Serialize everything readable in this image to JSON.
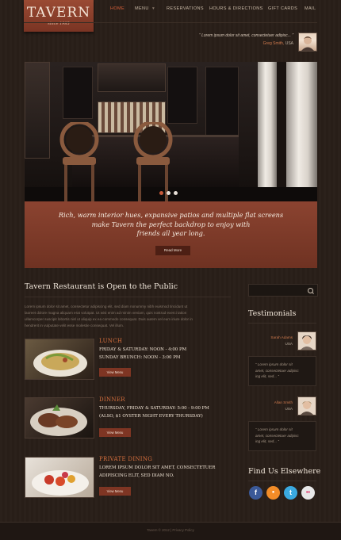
{
  "brand": {
    "name": "TAVERN",
    "since": "since 1985"
  },
  "nav": [
    {
      "label": "HOME",
      "active": true
    },
    {
      "label": "MENU"
    },
    {
      "label": "RESERVATIONS"
    },
    {
      "label": "HOURS & DIRECTIONS"
    },
    {
      "label": "GIFT CARDS"
    },
    {
      "label": "MAIL"
    }
  ],
  "header_testimonial": {
    "quote": "“ Lorem ipsum dolor sit amet, consectetuer adipisc... ”",
    "author": "Greg Smith,",
    "location": "USA"
  },
  "hero": {
    "caption": [
      "Rich, warm interior hues, expansive patios and multiple flat screens",
      "make Tavern the perfect backdrop to enjoy with",
      "friends all year long."
    ],
    "read_more": "Read More"
  },
  "main": {
    "title": "Tavern Restaurant is Open to the Public",
    "intro": [
      "Lorem ipsum dolor sit amet, consectetur adipiscing elit, sed diam nonummy nibh euismod tincidunt ut",
      "laoreet dolore magna aliquam erat volutpat. Ut wisi enim ad minim veniam, quis nostrud exerci tation",
      "ullamcorper suscipit lobortis nisl ut aliquip ex ea commodo consequat. Duis autem vel eum iriure dolor in",
      "hendrerit in vulputate velit esse molestie consequat. Vel illum."
    ],
    "cards": [
      {
        "heading": "LUNCH",
        "lines": [
          "FRIDAY & SATURDAY: NOON - 4:00 PM",
          "SUNDAY BRUNCH: NOON - 3:00 PM"
        ],
        "button": "View Menu"
      },
      {
        "heading": "DINNER",
        "lines": [
          "THURSDAY, FRIDAY & SATURDAY: 5:00 - 9:00 PM",
          "(ALSO, $1 OYSTER NIGHT EVERY THURSDAY)"
        ],
        "button": "View Menu"
      },
      {
        "heading": "PRIVATE DINING",
        "lines": [
          "LOREM IPSUM DOLOR SIT AMET, CONSECTETUER",
          "ADIPISCING ELIT, SED DIAM NO."
        ],
        "button": "View Menu"
      }
    ]
  },
  "sidebar": {
    "testimonials_title": "Testimonials",
    "testimonials": [
      {
        "name": "Sarah Adams",
        "location": "USA",
        "quote": [
          "“ Lorem ipsum dolor sit",
          "amet, consectetuer adipisc",
          "ing elit, sed... ”"
        ]
      },
      {
        "name": "Allan Smith",
        "location": "USA",
        "quote": [
          "“ Lorem ipsum dolor sit",
          "amet, consectetuer adipisc",
          "ing elit, sed... ”"
        ]
      }
    ],
    "social_title": "Find Us Elsewhere",
    "social": [
      {
        "icon": "facebook-icon",
        "glyph": "f",
        "color": "#3b5998"
      },
      {
        "icon": "rss-icon",
        "glyph": "●",
        "color": "#f28c28"
      },
      {
        "icon": "twitter-icon",
        "glyph": "t",
        "color": "#3aa9e0"
      },
      {
        "icon": "flickr-icon",
        "glyph": "••",
        "color": "#e8e8e8"
      }
    ]
  },
  "footer": {
    "text": "Tavern © 2012  |  Privacy Policy"
  }
}
